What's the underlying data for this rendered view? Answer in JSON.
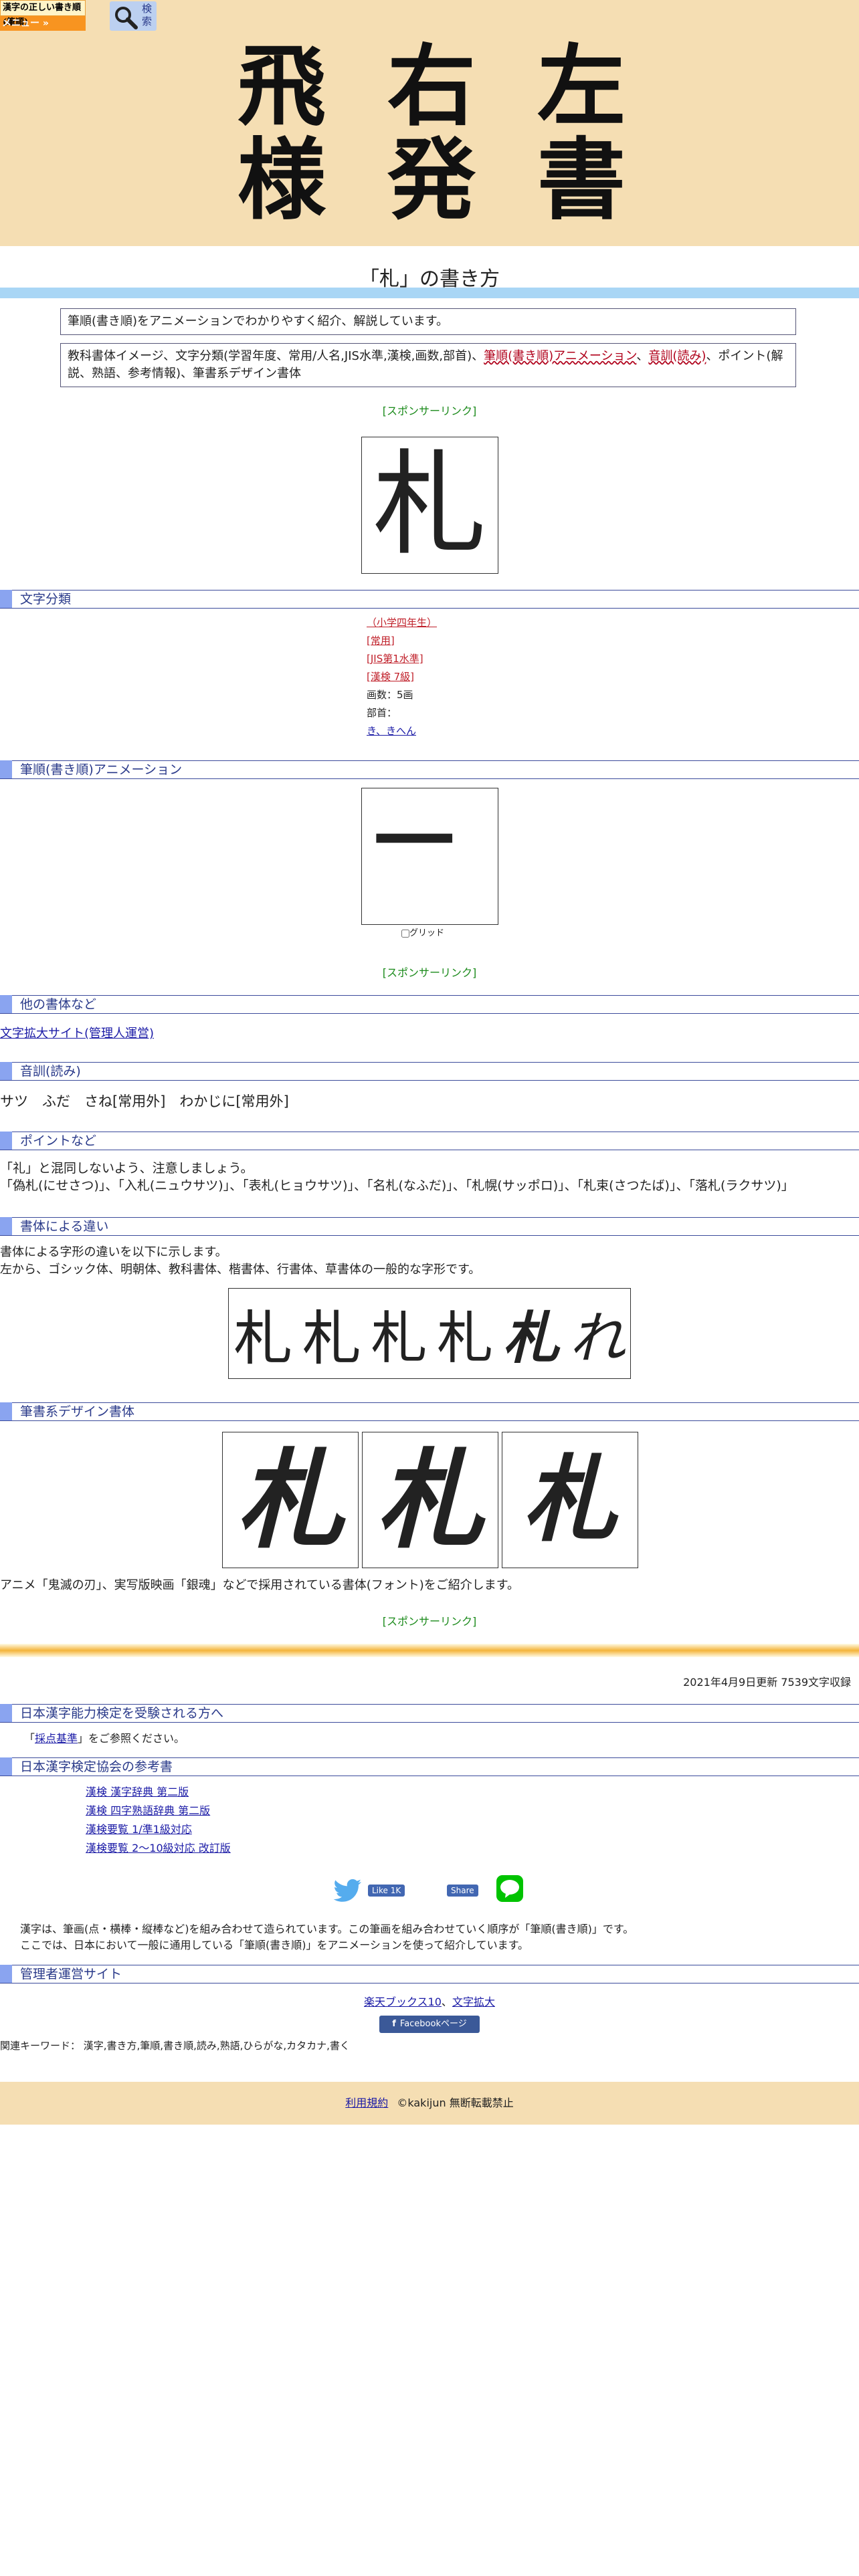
{
  "header": {
    "logo_text": "漢字の正しい書き順(筆順)",
    "menu_label": "メニュー »",
    "search_label": "検索",
    "hero_row1": [
      "飛",
      "右",
      "左"
    ],
    "hero_row2": [
      "様",
      "発",
      "書"
    ]
  },
  "page": {
    "title": "「札」の書き方",
    "intro": "筆順(書き順)をアニメーションでわかりやすく紹介、解説しています。",
    "contents_prefix": "教科書体イメージ、文字分類(学習年度、常用/人名,JIS水準,漢検,画数,部首)、",
    "contents_link1": "筆順(書き順)アニメーション",
    "contents_sep": "、",
    "contents_link2": "音訓(読み)",
    "contents_suffix": "、ポイント(解説、熟語、参考情報)、筆書系デザイン書体",
    "sponsor_link": "[スポンサーリンク]",
    "main_kanji": "札"
  },
  "classification": {
    "heading": "文字分類",
    "grade": "（小学四年生）",
    "jouyou": "[常用]",
    "jis": "[JIS第1水準]",
    "kanken": "[漢検 7級]",
    "strokes": "画数：5画",
    "radical_label": "部首：",
    "radical_value": "き、きへん"
  },
  "animation": {
    "heading": "筆順(書き順)アニメーション",
    "stroke_glyph": "一",
    "grid_label": "グリッド"
  },
  "other_fonts": {
    "heading": "他の書体など",
    "link": "文字拡大サイト(管理人運営)"
  },
  "readings": {
    "heading": "音訓(読み)",
    "text": "サツ　ふだ　さね[常用外]　わかじに[常用外]"
  },
  "points": {
    "heading": "ポイントなど",
    "line1": "「礼」と混同しないよう、注意しましょう。",
    "line2": "「偽札(にせさつ)」、「入札(ニュウサツ)」、「表札(ヒョウサツ)」、「名札(なふだ)」、「札幌(サッポロ)」、「札束(さつたば)」、「落札(ラクサツ)」"
  },
  "typefaces": {
    "heading": "書体による違い",
    "line1": "書体による字形の違いを以下に示します。",
    "line2": "左から、ゴシック体、明朝体、教科書体、楷書体、行書体、草書体の一般的な字形です。",
    "glyphs": [
      "札",
      "札",
      "札",
      "札",
      "札",
      "れ"
    ]
  },
  "design": {
    "heading": "筆書系デザイン書体",
    "glyphs": [
      "札",
      "札",
      "札"
    ],
    "caption": "アニメ「鬼滅の刃」、実写版映画「銀魂」などで採用されている書体(フォント)をご紹介します。"
  },
  "footer": {
    "updated": "2021年4月9日更新 7539文字収録",
    "exam_heading": "日本漢字能力検定を受験される方へ",
    "exam_link": "採点基準",
    "exam_prefix": "「",
    "exam_suffix": "」をご参照ください。",
    "books_heading": "日本漢字検定協会の参考書",
    "books": [
      "漢検 漢字辞典 第二版",
      "漢検 四字熟語辞典 第二版",
      "漢検要覧 1/準1級対応",
      "漢検要覧 2～10級対応 改訂版"
    ],
    "like_label": "Like 1K",
    "share_label": "Share",
    "explain1": "漢字は、筆画(点・横棒・縦棒など)を組み合わせて造られています。この筆画を組み合わせていく順序が「筆順(書き順)」です。",
    "explain2": "ここでは、日本において一般に通用している「筆順(書き順)」をアニメーションを使って紹介しています。",
    "admin_heading": "管理者運営サイト",
    "admin_link1": "楽天ブックス10",
    "admin_sep": "、",
    "admin_link2": "文字拡大",
    "fb_page": "Facebookページ",
    "keywords": "関連キーワード： 漢字,書き方,筆順,書き順,読み,熟語,ひらがな,カタカナ,書く",
    "terms": "利用規約",
    "copyright": "©kakijun 無断転載禁止"
  },
  "colors": {
    "hero_bg": "#f5deb3",
    "accent_band": "#a9d6f5",
    "section_marker": "#8aa4f0",
    "sponsor": "#1a8a1a"
  }
}
